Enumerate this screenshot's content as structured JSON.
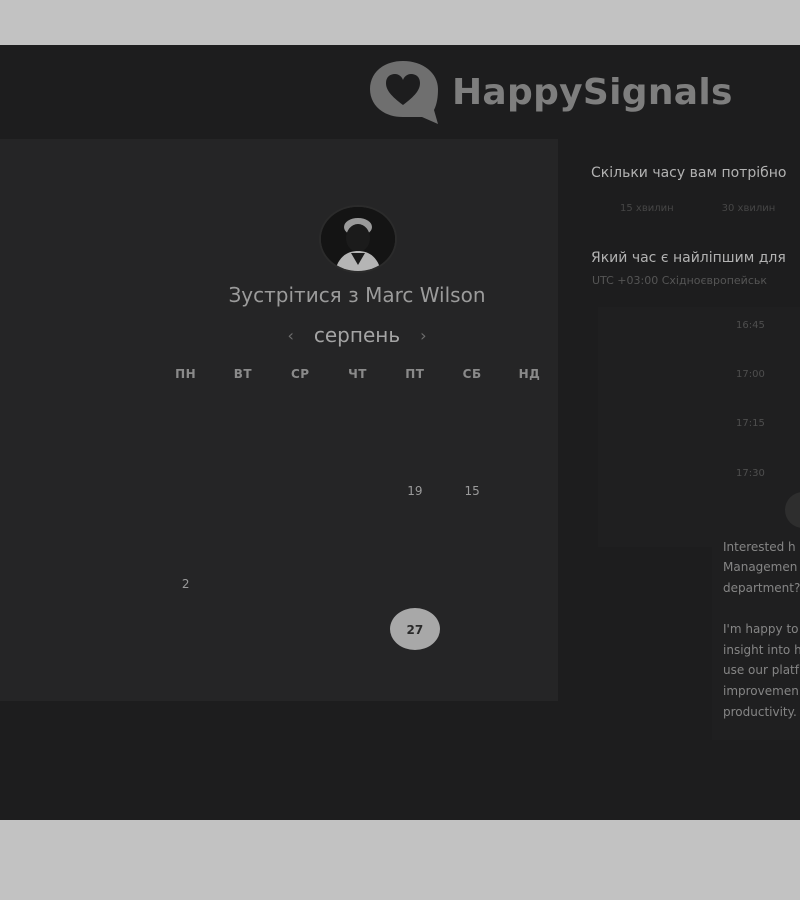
{
  "brand": {
    "name": "HappySignals",
    "icon": "heart-speech-bubble-icon"
  },
  "booking": {
    "title": "Зустрітися з Marc Wilson",
    "month": "серпень",
    "weekdays": [
      "ПН",
      "ВТ",
      "СР",
      "ЧТ",
      "ПТ",
      "СБ",
      "НД"
    ],
    "days": {
      "r0": [
        "",
        "",
        "",
        "",
        "",
        "",
        ""
      ],
      "r1": [
        "",
        "",
        "",
        "",
        "19",
        "15",
        ""
      ],
      "r2": [
        "",
        "",
        "",
        "",
        "",
        "",
        ""
      ],
      "r3": [
        "2",
        "",
        "",
        "",
        "",
        "",
        ""
      ],
      "r4": [
        "",
        "",
        "",
        "",
        "27",
        "",
        ""
      ]
    },
    "selected_day": "27"
  },
  "duration": {
    "question": "Скільки часу вам потрібно",
    "options": [
      "15 хвилин",
      "30 хвилин"
    ]
  },
  "time": {
    "question": "Який час є найліпшим для",
    "timezone": "UTC +03:00 Східноєвропейськ",
    "slots": [
      "16:45",
      "17:00",
      "17:15",
      "17:30"
    ]
  },
  "message": {
    "lines_1": [
      "Interested h",
      "Managemen",
      "department?"
    ],
    "lines_2": [
      "I'm happy to",
      "insight into h",
      "use our platf",
      "improvemen",
      "productivity."
    ]
  },
  "colors": {
    "page_bg": "#1d1d1e",
    "card_bg": "#252526",
    "selected_day_bg": "#a8a8a8",
    "outer_bg": "#c2c2c2"
  }
}
